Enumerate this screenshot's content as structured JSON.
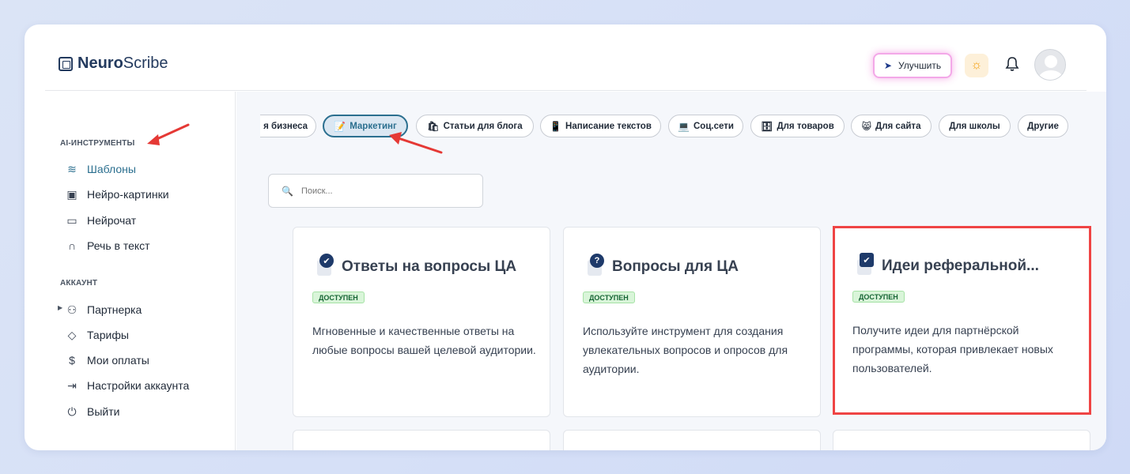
{
  "header": {
    "logo_bold": "Neuro",
    "logo_light": "Scribe",
    "upgrade_label": "Улучшить"
  },
  "sidebar": {
    "section_tools": "AI-ИНСТРУМЕНТЫ",
    "tools": [
      {
        "label": "Шаблоны",
        "icon": "layers-icon",
        "active": true
      },
      {
        "label": "Нейро-картинки",
        "icon": "image-icon"
      },
      {
        "label": "Нейрочат",
        "icon": "chat-icon"
      },
      {
        "label": "Речь в текст",
        "icon": "headphones-icon"
      }
    ],
    "section_account": "АККАУНТ",
    "account": [
      {
        "label": "Партнерка",
        "icon": "users-icon"
      },
      {
        "label": "Тарифы",
        "icon": "tag-icon"
      },
      {
        "label": "Мои оплаты",
        "icon": "dollar-icon"
      },
      {
        "label": "Настройки аккаунта",
        "icon": "login-icon"
      },
      {
        "label": "Выйти",
        "icon": "power-icon"
      }
    ]
  },
  "categories": [
    {
      "label": "я бизнеса",
      "emoji": ""
    },
    {
      "label": "Маркетинг",
      "emoji": "📝",
      "active": true
    },
    {
      "label": "Статьи для блога",
      "emoji": "🛍"
    },
    {
      "label": "Написание текстов",
      "emoji": "📱"
    },
    {
      "label": "Соц.сети",
      "emoji": "💻"
    },
    {
      "label": "Для товаров",
      "emoji": "🗄"
    },
    {
      "label": "Для сайта",
      "emoji": "😸"
    },
    {
      "label": "Для школы",
      "emoji": ""
    },
    {
      "label": "Другие",
      "emoji": ""
    }
  ],
  "search": {
    "placeholder": "Поиск..."
  },
  "cards": [
    {
      "title": "Ответы на вопросы ЦА",
      "badge": "✔",
      "tag": "ДОСТУПЕН",
      "desc": "Мгновенные и качественные ответы на любые вопросы вашей целевой аудитории."
    },
    {
      "title": "Вопросы для ЦА",
      "badge": "?",
      "tag": "ДОСТУПЕН",
      "desc": "Используйте инструмент для создания увлекательных вопросов и опросов для аудитории."
    },
    {
      "title": "Идеи реферальной...",
      "badge": "✔",
      "tag": "ДОСТУПЕН",
      "desc": "Получите идеи для партнёрской программы, которая привлекает новых пользователей."
    }
  ],
  "colors": {
    "accent": "#2b6f8f",
    "highlight": "#ef4444",
    "arrow": "#e53935",
    "tag_bg": "#d9f5d9"
  }
}
